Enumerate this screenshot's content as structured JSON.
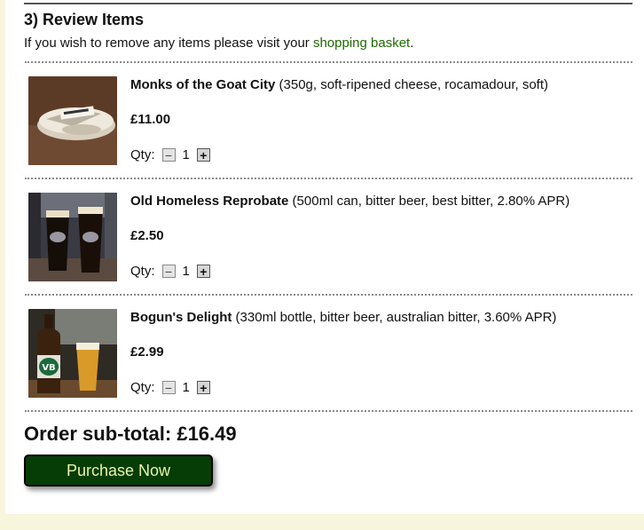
{
  "section": {
    "heading": "3) Review Items",
    "intro_text": "If you wish to remove any items please visit your ",
    "basket_link": "shopping basket",
    "intro_end": "."
  },
  "items": [
    {
      "name": "Monks of the Goat City",
      "details": " (350g, soft-ripened cheese, rocamadour, soft)",
      "price": "£11.00",
      "qty_label": "Qty:",
      "qty": "1",
      "image": "cheese-photo"
    },
    {
      "name": "Old Homeless Reprobate",
      "details": " (500ml can, bitter beer, best bitter, 2.80% APR)",
      "price": "£2.50",
      "qty_label": "Qty:",
      "qty": "1",
      "image": "beer-glasses-photo"
    },
    {
      "name": "Bogun's Delight",
      "details": " (330ml bottle, bitter beer, australian bitter, 3.60% APR)",
      "price": "£2.99",
      "qty_label": "Qty:",
      "qty": "1",
      "image": "beer-bottle-photo"
    }
  ],
  "qty_controls": {
    "minus": "−",
    "plus": "+"
  },
  "order": {
    "subtotal_text": "Order sub-total: £16.49",
    "purchase_label": "Purchase Now"
  },
  "colors": {
    "page_bg": "#f7f6dc",
    "link": "#1d6b00",
    "button_bg": "#063d06",
    "button_text": "#e8f4a8"
  }
}
